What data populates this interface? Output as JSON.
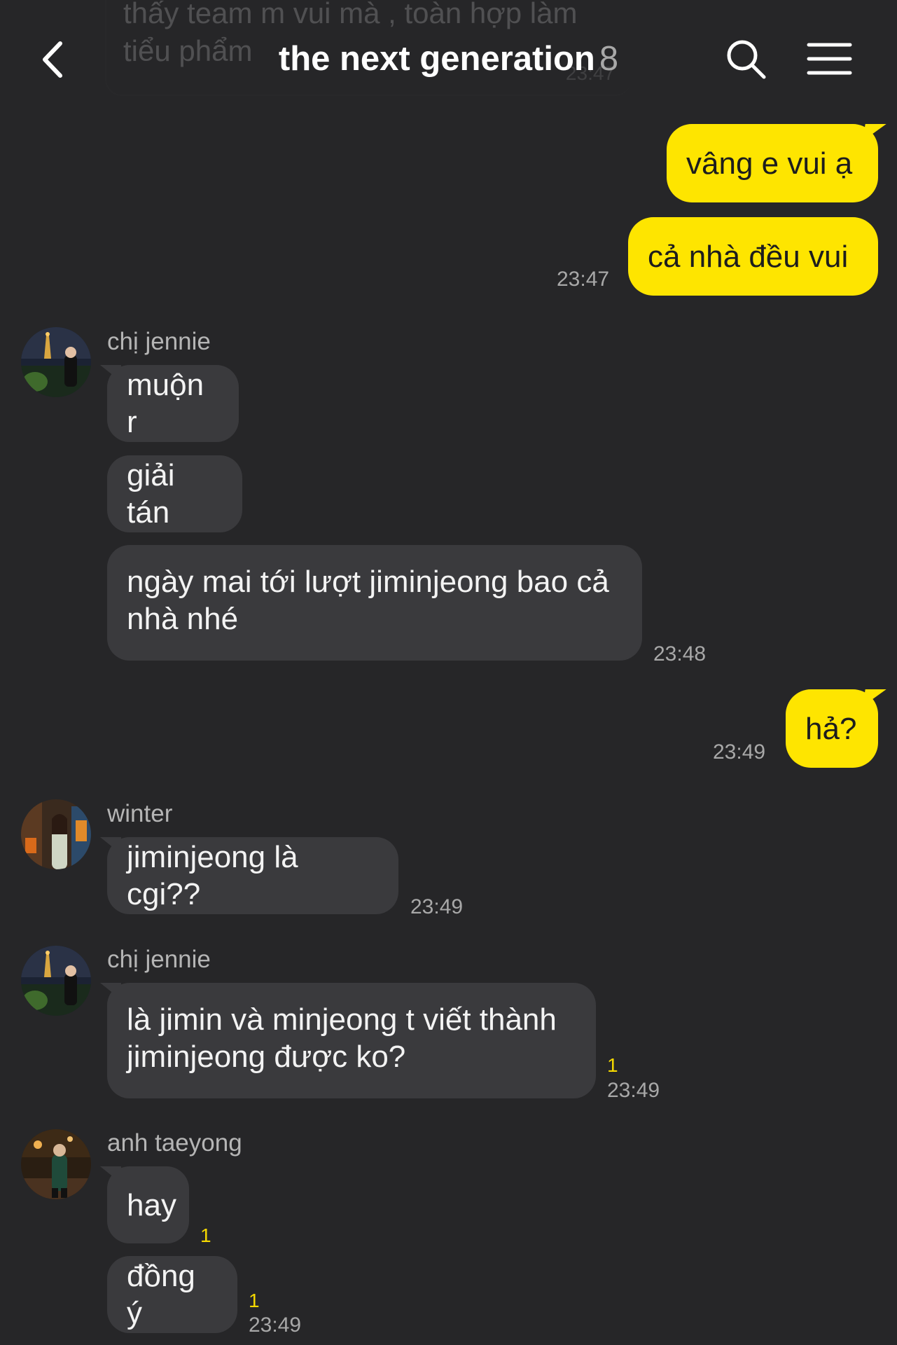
{
  "header": {
    "title": "the next generation",
    "member_count": "8"
  },
  "faded_previous": {
    "text": "thấy team m vui mà , toàn hợp làm\ntiểu phẩm",
    "time": "23:47"
  },
  "messages": {
    "m1": {
      "text": "vâng e vui ạ"
    },
    "m2": {
      "text": "cả nhà đều vui",
      "time": "23:47"
    },
    "g1": {
      "sender": "chị jennie",
      "b1": "muộn r",
      "b2": "giải tán",
      "b3": "ngày mai tới lượt jiminjeong bao cả nhà nhé",
      "time": "23:48"
    },
    "m3": {
      "text": "hả?",
      "time": "23:49"
    },
    "g2": {
      "sender": "winter",
      "b1": "jiminjeong là cgi??",
      "time": "23:49"
    },
    "g3": {
      "sender": "chị jennie",
      "b1": "là jimin và minjeong t viết thành jiminjeong được ko?",
      "unread": "1",
      "time": "23:49"
    },
    "g4": {
      "sender": "anh taeyong",
      "b1": "hay",
      "b1_unread": "1",
      "b2": "đồng ý",
      "b2_unread": "1",
      "time": "23:49"
    }
  },
  "icons": {
    "back": "chevron-left-icon",
    "search": "search-icon",
    "menu": "hamburger-menu-icon"
  },
  "colors": {
    "background": "#262628",
    "my_bubble": "#fee500",
    "their_bubble": "#3a3a3d",
    "unread_count": "#f5d800"
  }
}
